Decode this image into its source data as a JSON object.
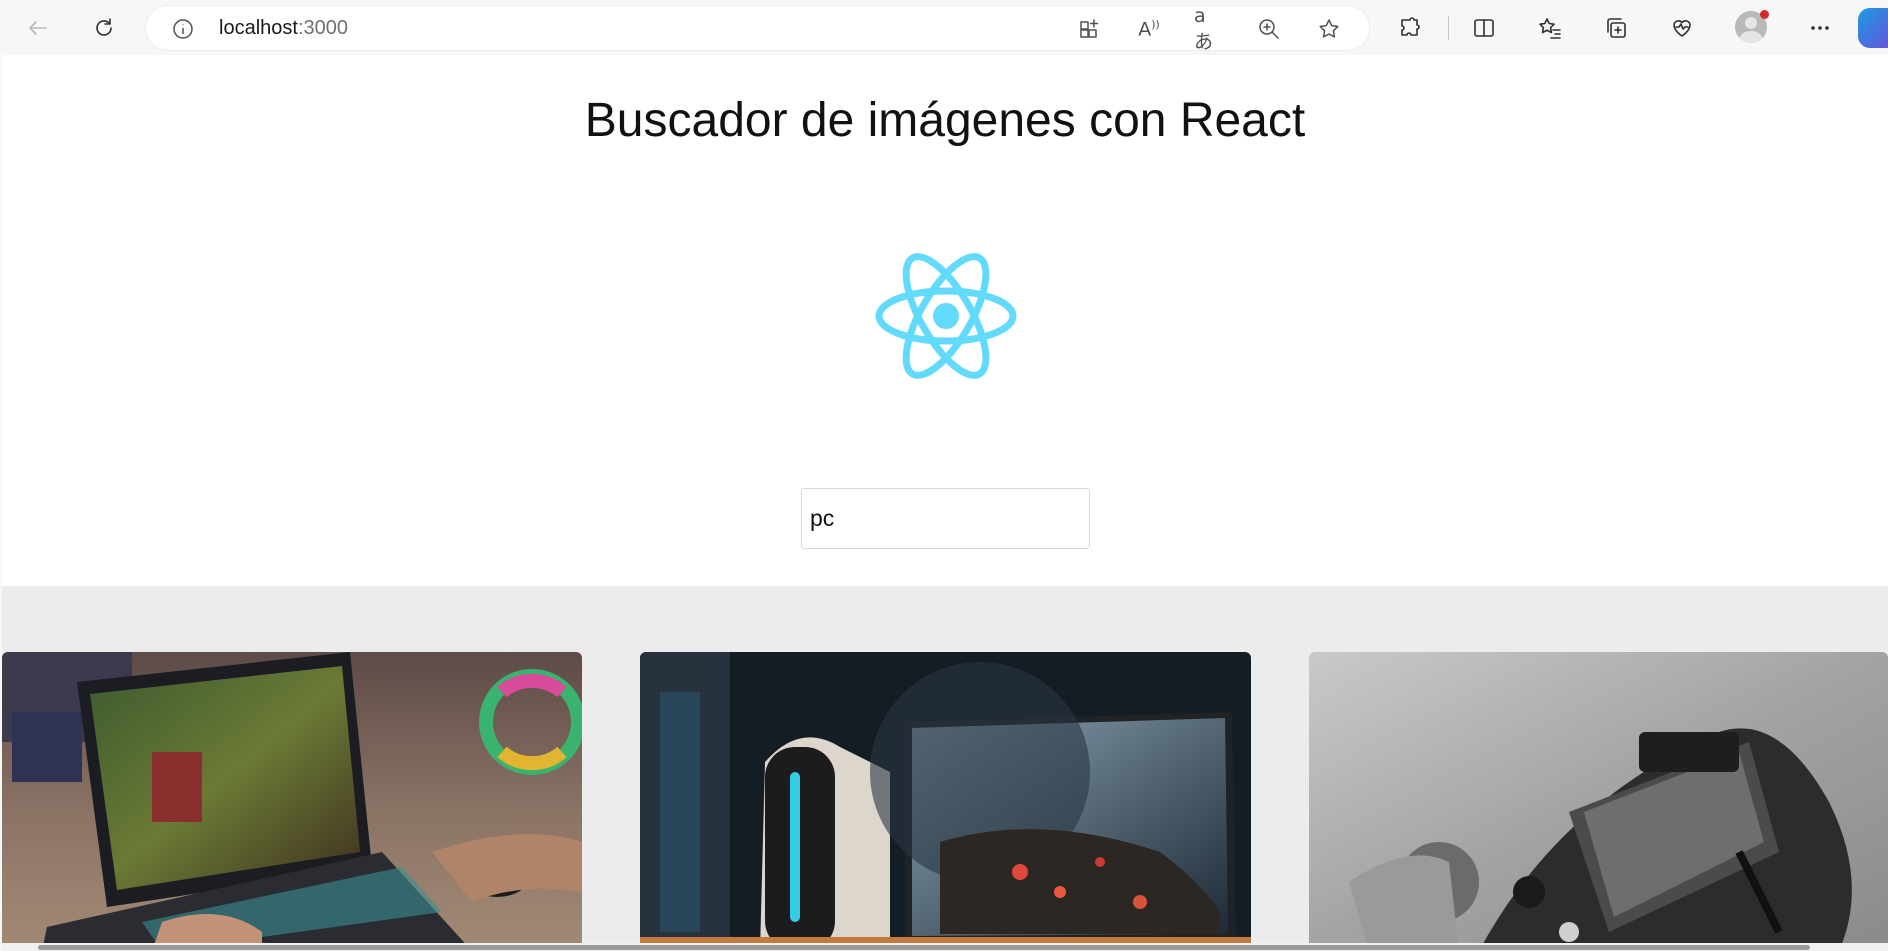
{
  "browser": {
    "url_host": "localhost",
    "url_port": ":3000",
    "icons": [
      "back-icon",
      "refresh-icon",
      "site-info-icon",
      "apps-icon",
      "read-aloud-icon",
      "translate-icon",
      "zoom-icon",
      "favorite-star-icon",
      "extensions-icon",
      "split-screen-icon",
      "favorites-icon",
      "collections-icon",
      "browser-essentials-icon",
      "profile-avatar",
      "more-menu-icon",
      "copilot-icon"
    ]
  },
  "page": {
    "title": "Buscador de imágenes con React",
    "logo": "react-logo-icon",
    "search": {
      "value": "pc",
      "placeholder": ""
    },
    "results": [
      {
        "name": "laptop-gaming-photo"
      },
      {
        "name": "desktop-pc-monitor-photo"
      },
      {
        "name": "phone-controller-photo"
      }
    ]
  },
  "colors": {
    "react_logo": "#61dafb",
    "page_bg": "#ececec",
    "header_bg": "#ffffff"
  }
}
